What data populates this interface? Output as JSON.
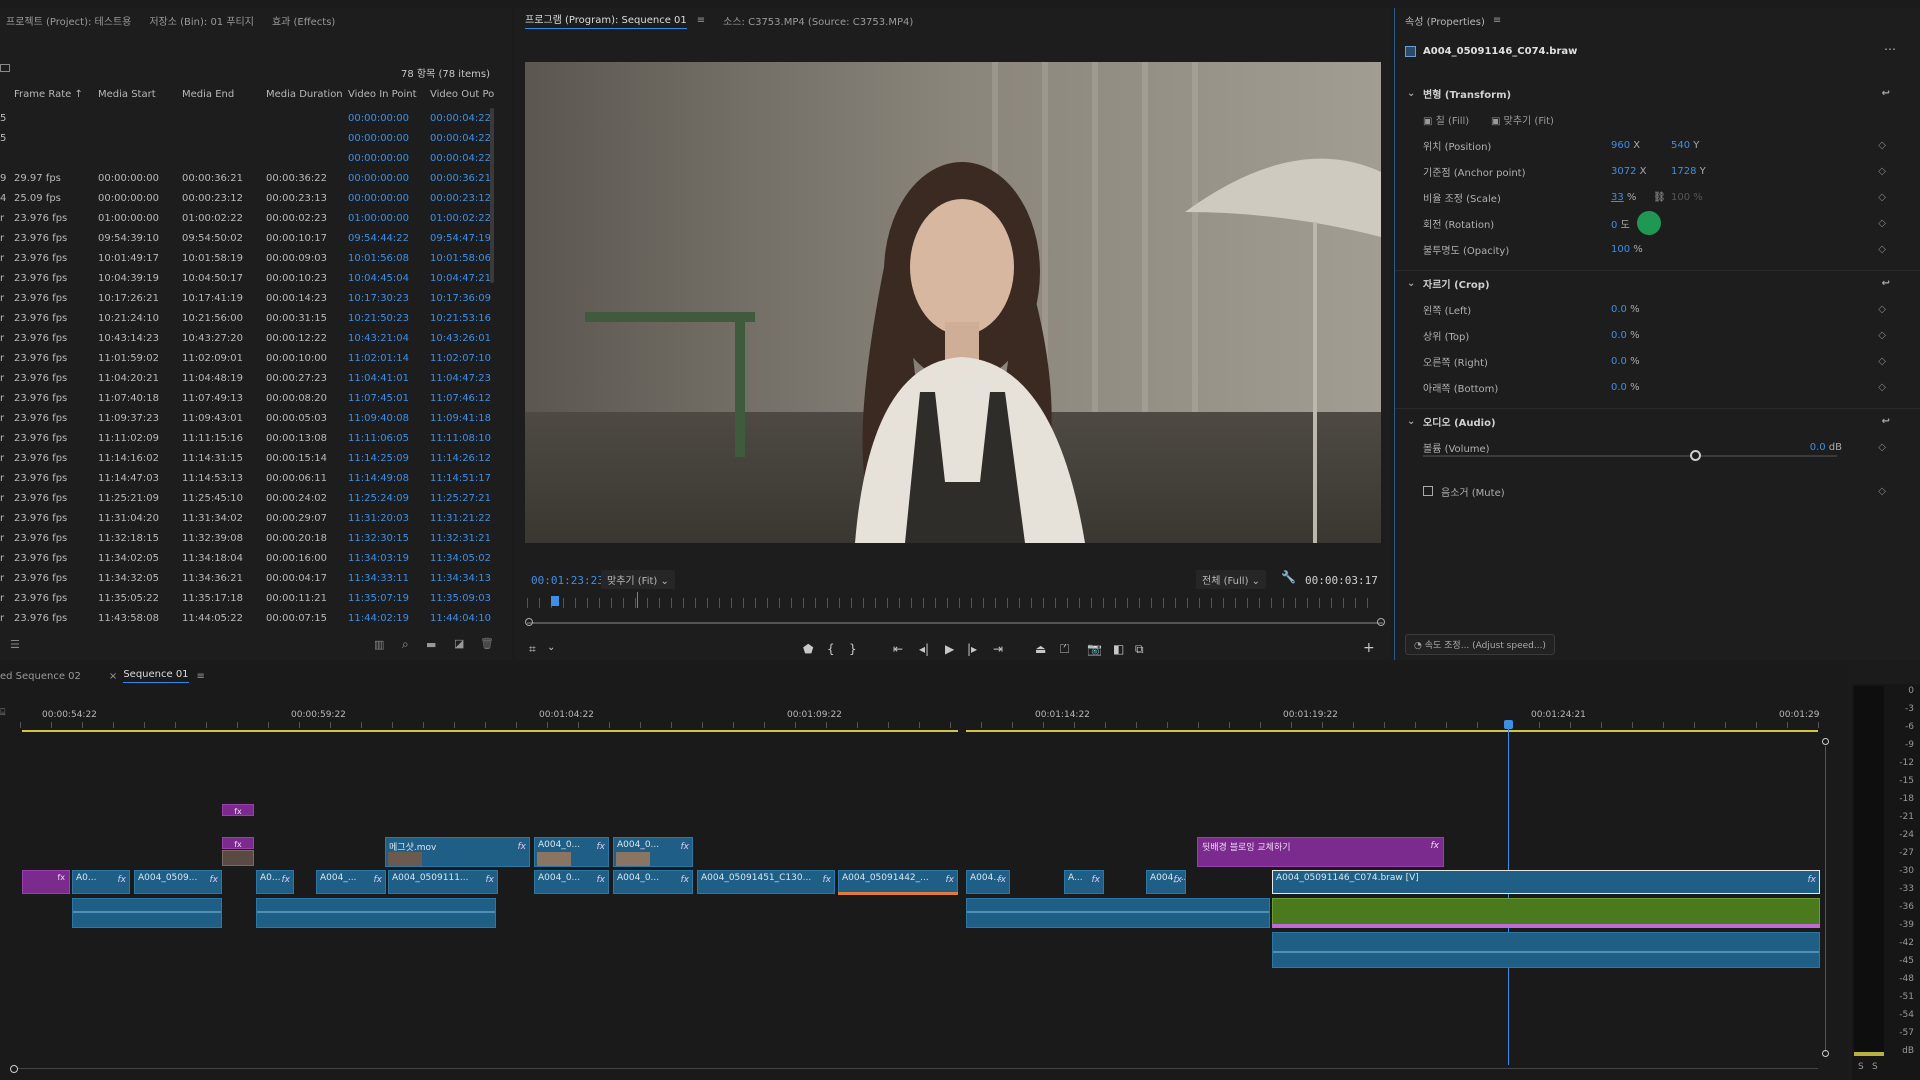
{
  "project_panel": {
    "tabs": [
      "프로젝트 (Project): 테스트용",
      "저장소 (Bin): 01 푸티지",
      "효과 (Effects)"
    ],
    "item_count": "78 항목 (78 items)",
    "columns": [
      "Frame Rate ↑",
      "Media Start",
      "Media End",
      "Media Duration",
      "Video In Point",
      "Video Out Poir"
    ],
    "rows": [
      {
        "p": "5",
        "fr": "",
        "ms": "",
        "me": "",
        "md": "",
        "vi": "00:00:00:00",
        "vo": "00:00:04:22"
      },
      {
        "p": "5",
        "fr": "",
        "ms": "",
        "me": "",
        "md": "",
        "vi": "00:00:00:00",
        "vo": "00:00:04:22"
      },
      {
        "p": "",
        "fr": "",
        "ms": "",
        "me": "",
        "md": "",
        "vi": "00:00:00:00",
        "vo": "00:00:04:22"
      },
      {
        "p": "9",
        "fr": "29.97 fps",
        "ms": "00:00:00:00",
        "me": "00:00:36:21",
        "md": "00:00:36:22",
        "vi": "00:00:00:00",
        "vo": "00:00:36:21"
      },
      {
        "p": "4",
        "fr": "25.09 fps",
        "ms": "00:00:00:00",
        "me": "00:00:23:12",
        "md": "00:00:23:13",
        "vi": "00:00:00:00",
        "vo": "00:00:23:12"
      },
      {
        "p": "r",
        "fr": "23.976 fps",
        "ms": "01:00:00:00",
        "me": "01:00:02:22",
        "md": "00:00:02:23",
        "vi": "01:00:00:00",
        "vo": "01:00:02:22"
      },
      {
        "p": "r",
        "fr": "23.976 fps",
        "ms": "09:54:39:10",
        "me": "09:54:50:02",
        "md": "00:00:10:17",
        "vi": "09:54:44:22",
        "vo": "09:54:47:19"
      },
      {
        "p": "r",
        "fr": "23.976 fps",
        "ms": "10:01:49:17",
        "me": "10:01:58:19",
        "md": "00:00:09:03",
        "vi": "10:01:56:08",
        "vo": "10:01:58:06"
      },
      {
        "p": "r",
        "fr": "23.976 fps",
        "ms": "10:04:39:19",
        "me": "10:04:50:17",
        "md": "00:00:10:23",
        "vi": "10:04:45:04",
        "vo": "10:04:47:21"
      },
      {
        "p": "r",
        "fr": "23.976 fps",
        "ms": "10:17:26:21",
        "me": "10:17:41:19",
        "md": "00:00:14:23",
        "vi": "10:17:30:23",
        "vo": "10:17:36:09"
      },
      {
        "p": "r",
        "fr": "23.976 fps",
        "ms": "10:21:24:10",
        "me": "10:21:56:00",
        "md": "00:00:31:15",
        "vi": "10:21:50:23",
        "vo": "10:21:53:16"
      },
      {
        "p": "r",
        "fr": "23.976 fps",
        "ms": "10:43:14:23",
        "me": "10:43:27:20",
        "md": "00:00:12:22",
        "vi": "10:43:21:04",
        "vo": "10:43:26:01"
      },
      {
        "p": "r",
        "fr": "23.976 fps",
        "ms": "11:01:59:02",
        "me": "11:02:09:01",
        "md": "00:00:10:00",
        "vi": "11:02:01:14",
        "vo": "11:02:07:10"
      },
      {
        "p": "r",
        "fr": "23.976 fps",
        "ms": "11:04:20:21",
        "me": "11:04:48:19",
        "md": "00:00:27:23",
        "vi": "11:04:41:01",
        "vo": "11:04:47:23"
      },
      {
        "p": "r",
        "fr": "23.976 fps",
        "ms": "11:07:40:18",
        "me": "11:07:49:13",
        "md": "00:00:08:20",
        "vi": "11:07:45:01",
        "vo": "11:07:46:12"
      },
      {
        "p": "r",
        "fr": "23.976 fps",
        "ms": "11:09:37:23",
        "me": "11:09:43:01",
        "md": "00:00:05:03",
        "vi": "11:09:40:08",
        "vo": "11:09:41:18"
      },
      {
        "p": "r",
        "fr": "23.976 fps",
        "ms": "11:11:02:09",
        "me": "11:11:15:16",
        "md": "00:00:13:08",
        "vi": "11:11:06:05",
        "vo": "11:11:08:10"
      },
      {
        "p": "r",
        "fr": "23.976 fps",
        "ms": "11:14:16:02",
        "me": "11:14:31:15",
        "md": "00:00:15:14",
        "vi": "11:14:25:09",
        "vo": "11:14:26:12"
      },
      {
        "p": "r",
        "fr": "23.976 fps",
        "ms": "11:14:47:03",
        "me": "11:14:53:13",
        "md": "00:00:06:11",
        "vi": "11:14:49:08",
        "vo": "11:14:51:17"
      },
      {
        "p": "r",
        "fr": "23.976 fps",
        "ms": "11:25:21:09",
        "me": "11:25:45:10",
        "md": "00:00:24:02",
        "vi": "11:25:24:09",
        "vo": "11:25:27:21"
      },
      {
        "p": "r",
        "fr": "23.976 fps",
        "ms": "11:31:04:20",
        "me": "11:31:34:02",
        "md": "00:00:29:07",
        "vi": "11:31:20:03",
        "vo": "11:31:21:22"
      },
      {
        "p": "r",
        "fr": "23.976 fps",
        "ms": "11:32:18:15",
        "me": "11:32:39:08",
        "md": "00:00:20:18",
        "vi": "11:32:30:15",
        "vo": "11:32:31:21"
      },
      {
        "p": "r",
        "fr": "23.976 fps",
        "ms": "11:34:02:05",
        "me": "11:34:18:04",
        "md": "00:00:16:00",
        "vi": "11:34:03:19",
        "vo": "11:34:05:02"
      },
      {
        "p": "r",
        "fr": "23.976 fps",
        "ms": "11:34:32:05",
        "me": "11:34:36:21",
        "md": "00:00:04:17",
        "vi": "11:34:33:11",
        "vo": "11:34:34:13"
      },
      {
        "p": "r",
        "fr": "23.976 fps",
        "ms": "11:35:05:22",
        "me": "11:35:17:18",
        "md": "00:00:11:21",
        "vi": "11:35:07:19",
        "vo": "11:35:09:03"
      },
      {
        "p": "r",
        "fr": "23.976 fps",
        "ms": "11:43:58:08",
        "me": "11:44:05:22",
        "md": "00:00:07:15",
        "vi": "11:44:02:19",
        "vo": "11:44:04:10"
      }
    ]
  },
  "program_monitor": {
    "tabs": [
      "프로그램 (Program): Sequence 01",
      "소스: C3753.MP4 (Source: C3753.MP4)"
    ],
    "current_time": "00:01:23:23",
    "fit_label": "맞추기 (Fit)",
    "quality_label": "전체 (Full)",
    "duration": "00:00:03:17"
  },
  "properties": {
    "tab": "속성 (Properties)",
    "clip_name": "A004_05091146_C074.braw",
    "transform": {
      "title": "변형 (Transform)",
      "fill_label": "칠 (Fill)",
      "fit_label": "맞추기 (Fit)",
      "position_label": "위치 (Position)",
      "position_x": "960",
      "position_y": "540",
      "anchor_label": "기준점 (Anchor point)",
      "anchor_x": "3072",
      "anchor_y": "1728",
      "scale_label": "비율 조정 (Scale)",
      "scale": "33",
      "scale_width": "100 %",
      "rotation_label": "회전 (Rotation)",
      "rotation": "0",
      "opacity_label": "불투명도 (Opacity)",
      "opacity": "100"
    },
    "crop": {
      "title": "자르기 (Crop)",
      "left_label": "왼쪽 (Left)",
      "left": "0.0",
      "top_label": "상위 (Top)",
      "top": "0.0",
      "right_label": "오른쪽 (Right)",
      "right": "0.0",
      "bottom_label": "아래쪽 (Bottom)",
      "bottom": "0.0"
    },
    "audio": {
      "title": "오디오 (Audio)",
      "volume_label": "볼륨 (Volume)",
      "volume": "0.0",
      "mute_label": "음소거 (Mute)"
    },
    "adjust_speed": "속도 조정... (Adjust speed...)"
  },
  "timeline": {
    "tabs": [
      "ed Sequence 02",
      "Sequence 01"
    ],
    "ruler": [
      "00:00:54:22",
      "00:00:59:22",
      "00:01:04:22",
      "00:01:09:22",
      "00:01:14:22",
      "00:01:19:22",
      "00:01:24:21",
      "00:01:29"
    ],
    "v2_clips": [
      "메그샷.mov",
      "A004_0...",
      "A004_0...",
      "뒷배경 블로잉 교체하기"
    ],
    "v1_clips": [
      "A0...",
      "A004_0509...",
      "A0...",
      "A004_...",
      "A004_0509111...",
      "A004_0...",
      "A004_0...",
      "A004_05091451_C130...",
      "A004_05091442_...",
      "A004...",
      "A...",
      "A004_...",
      "A004_05091146_C074.braw [V]"
    ],
    "meter": [
      "0",
      "-3",
      "-6",
      "-9",
      "-12",
      "-15",
      "-18",
      "-21",
      "-24",
      "-27",
      "-30",
      "-33",
      "-36",
      "-39",
      "-42",
      "-45",
      "-48",
      "-51",
      "-54",
      "-57",
      "dB"
    ],
    "meter_bottom": [
      "S",
      "S"
    ]
  }
}
